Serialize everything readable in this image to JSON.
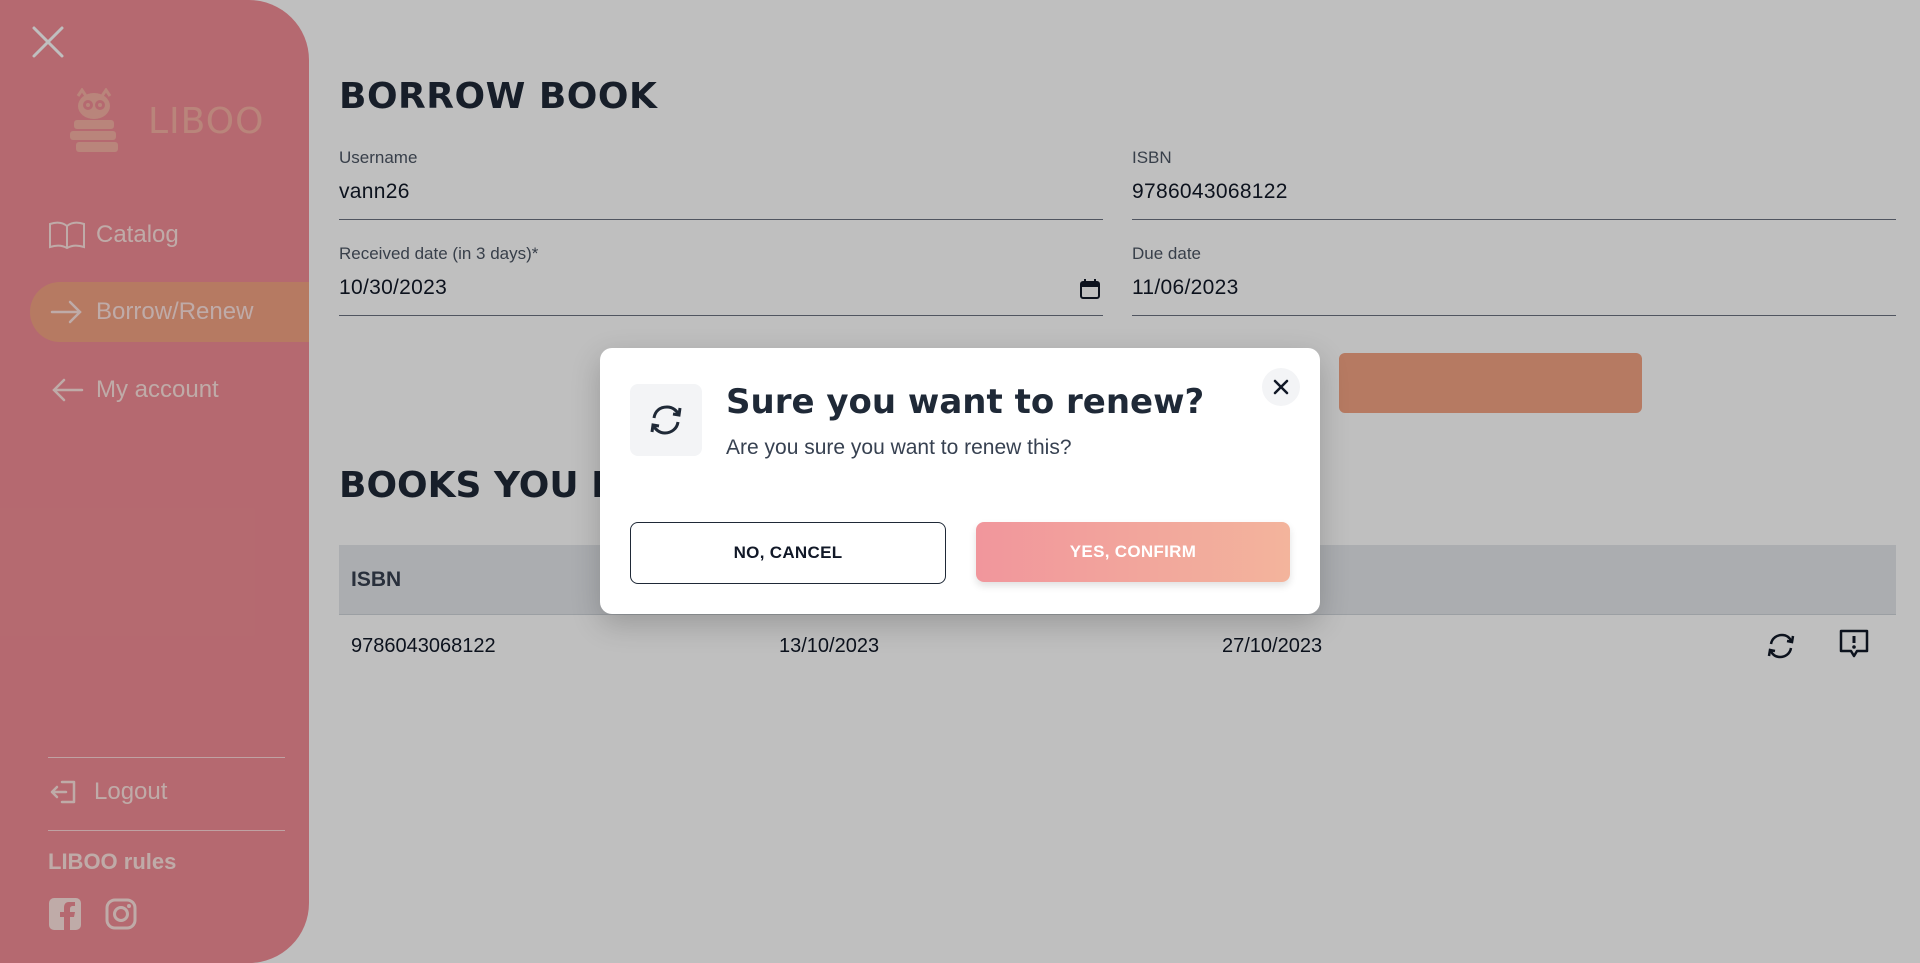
{
  "sidebar": {
    "brand_name": "LIBOO",
    "items": [
      {
        "label": "Catalog"
      },
      {
        "label": "Borrow/Renew"
      },
      {
        "label": "My account"
      }
    ],
    "logout_label": "Logout",
    "rules_label": "LIBOO rules",
    "social": [
      "facebook-icon",
      "instagram-icon"
    ]
  },
  "borrow": {
    "title": "BORROW BOOK",
    "username": {
      "label": "Username",
      "value": "vann26"
    },
    "isbn": {
      "label": "ISBN",
      "value": "9786043068122"
    },
    "received": {
      "label": "Received date (in 3 days)*",
      "value": "10/30/2023"
    },
    "due": {
      "label": "Due date",
      "value": "11/06/2023"
    }
  },
  "books": {
    "title": "BOOKS YOU HA",
    "columns": [
      "ISBN"
    ],
    "rows": [
      {
        "isbn": "9786043068122",
        "borrow_date": "13/10/2023",
        "due_date": "27/10/2023"
      }
    ]
  },
  "modal": {
    "title": "Sure you want to renew?",
    "message": "Are you sure you want to renew this?",
    "cancel_label": "NO, CANCEL",
    "confirm_label": "YES, CONFIRM"
  },
  "colors": {
    "sidebar": "#f28d96",
    "active_item": "#f3a383",
    "confirm_start": "#f1969c",
    "confirm_end": "#f3b49c"
  }
}
